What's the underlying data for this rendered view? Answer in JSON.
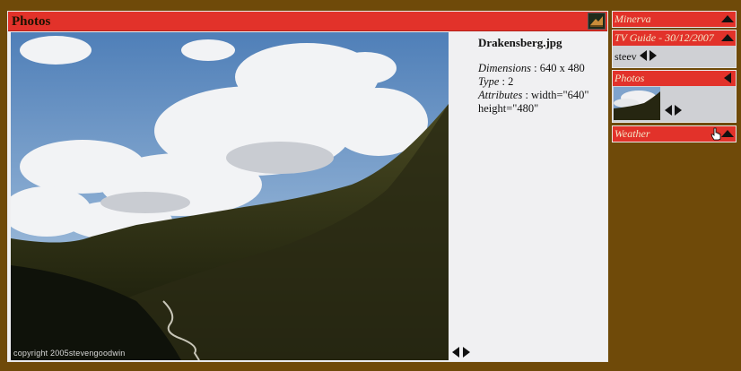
{
  "main": {
    "title": "Photos",
    "photo_credit": "copyright 2005stevengoodwin",
    "file": {
      "name": "Drakensberg.jpg",
      "dimensions_label": "Dimensions",
      "dimensions_value": " : 640 x 480",
      "type_label": "Type",
      "type_value": " : 2",
      "attributes_label": "Attributes",
      "attributes_value": " : width=\"640\" height=\"480\""
    }
  },
  "sidebar": {
    "minerva": {
      "title": "Minerva"
    },
    "tv_guide": {
      "title": "TV Guide - 30/12/2007",
      "user": "steev"
    },
    "photos": {
      "title": "Photos"
    },
    "weather": {
      "title": "Weather"
    }
  },
  "colors": {
    "background": "#6f4a09",
    "header_red": "#e2322a",
    "panel": "#f0f0f2",
    "widget_body": "#cfd0d4"
  }
}
